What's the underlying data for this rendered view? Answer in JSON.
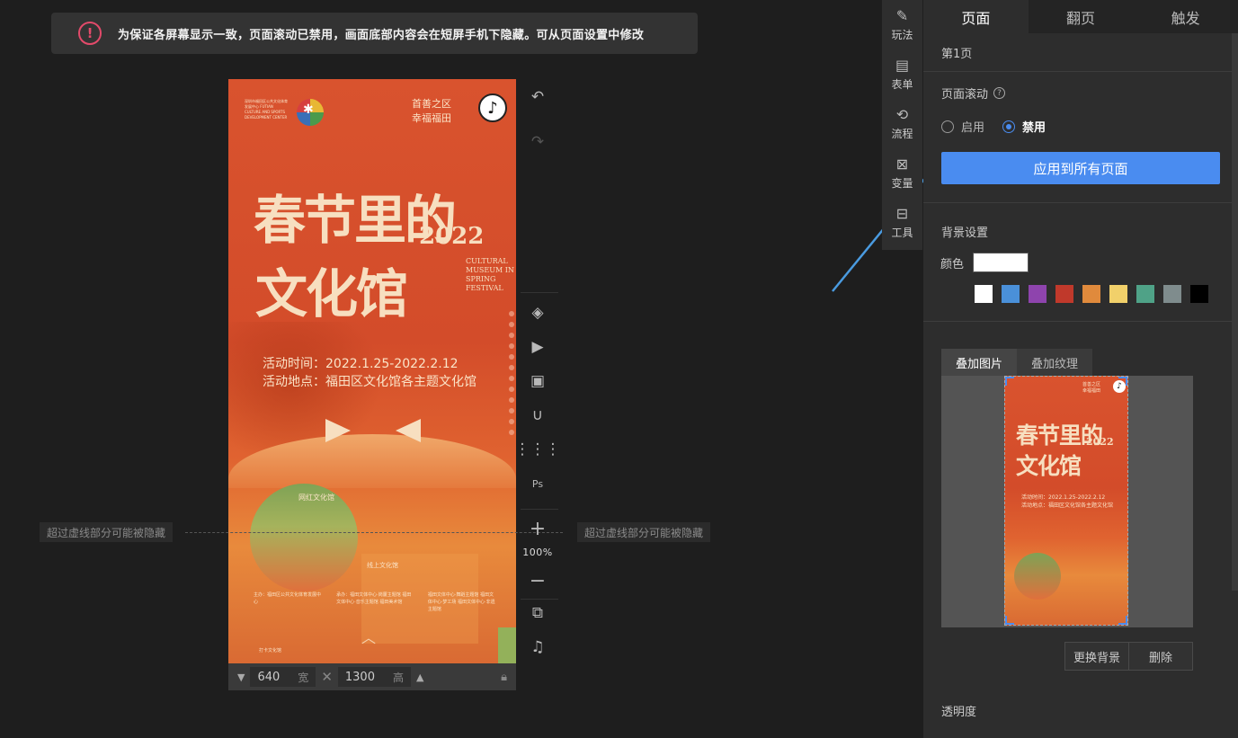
{
  "notice": {
    "text": "为保证各屏幕显示一致，页面滚动已禁用，画面底部内容会在短屏手机下隐藏。可从页面设置中修改"
  },
  "poster": {
    "org": "深圳市福田区公共文化体育发展中心 FUTIAN CULTURE AND SPORTS DEVELOPMENT CENTER",
    "slogan_line1": "首善之区",
    "slogan_line2": "幸福福田",
    "title_line1": "春节里的",
    "title_line2": "文化馆",
    "year": "2022",
    "english": "CULTURAL MUSEUM IN SPRING FESTIVAL",
    "time": "活动时间：2022.1.25-2022.2.12",
    "place": "活动地点：福田区文化馆各主题文化馆",
    "label_circle": "网红文化馆",
    "label_block": "线上文化馆",
    "host": "主办：福田区公共文化体育发展中心",
    "organizers": "承办：福田文体中心·岗厦主题馆 福田文体中心·音乐主题馆 福田美术馆",
    "organizers2": "福田文体中心·舞蹈主题馆 福田文体中心·梦工场 福田文体中心·非遗主题馆",
    "footer": "打卡文化馆"
  },
  "canvas": {
    "width": "640",
    "width_unit": "宽",
    "height": "1300",
    "height_unit": "高",
    "hint_left": "超过虚线部分可能被隐藏",
    "hint_right": "超过虚线部分可能被隐藏",
    "zoom": "100%"
  },
  "side_tabs": [
    {
      "label": "玩法",
      "icon": "gameplay-icon"
    },
    {
      "label": "表单",
      "icon": "form-icon"
    },
    {
      "label": "流程",
      "icon": "flow-icon"
    },
    {
      "label": "变量",
      "icon": "variable-icon"
    },
    {
      "label": "工具",
      "icon": "toolbox-icon"
    }
  ],
  "panel": {
    "tabs": [
      "页面",
      "翻页",
      "触发"
    ],
    "page_name": "第1页",
    "scroll_label": "页面滚动",
    "radio_enable": "启用",
    "radio_disable": "禁用",
    "apply_button": "应用到所有页面",
    "bg_label": "背景设置",
    "color_label": "颜色",
    "swatches": [
      "#ffffff",
      "#4a90d9",
      "#8e44ad",
      "#c0392b",
      "#e08a3c",
      "#f1d06a",
      "#4fa287",
      "#7f8c8d",
      "#000000"
    ],
    "overlay_tab_image": "叠加图片",
    "overlay_tab_texture": "叠加纹理",
    "replace_bg": "更换背景",
    "delete": "删除",
    "opacity_label": "透明度"
  },
  "colors": {
    "accent": "#4a8cf0",
    "alert": "#e34a6a"
  }
}
